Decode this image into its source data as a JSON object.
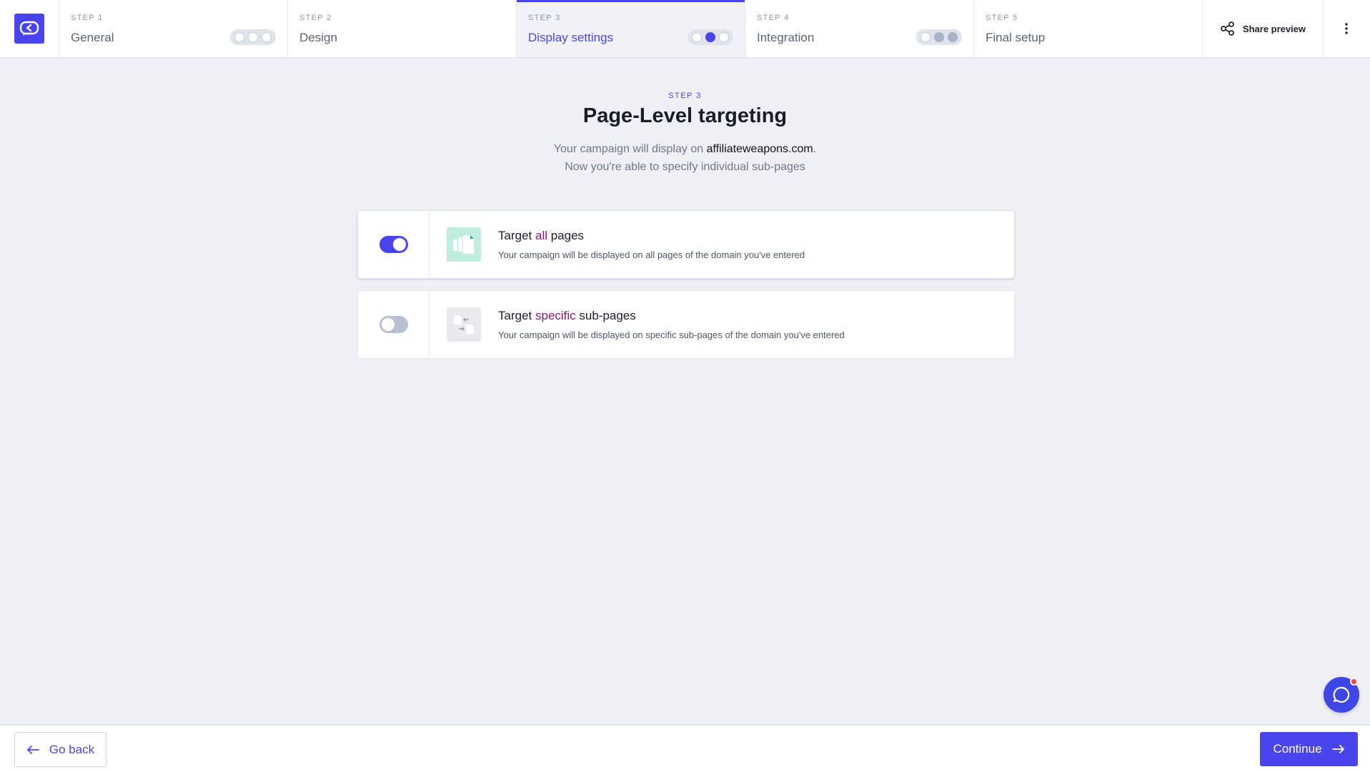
{
  "steps": [
    {
      "kicker": "STEP 1",
      "title": "General",
      "dots": [
        "empty",
        "empty",
        "empty"
      ]
    },
    {
      "kicker": "STEP 2",
      "title": "Design"
    },
    {
      "kicker": "STEP 3",
      "title": "Display settings",
      "active": true,
      "dots": [
        "empty",
        "filled",
        "empty"
      ]
    },
    {
      "kicker": "STEP 4",
      "title": "Integration",
      "dots": [
        "empty",
        "muted",
        "muted"
      ]
    },
    {
      "kicker": "STEP 5",
      "title": "Final setup"
    }
  ],
  "toolbar": {
    "share_label": "Share preview"
  },
  "header": {
    "kicker": "STEP 3",
    "title": "Page-Level targeting",
    "line1_prefix": "Your campaign will display on ",
    "domain": "affiliateweapons.com",
    "line1_suffix": ".",
    "line2": "Now you're able to specify individual sub-pages"
  },
  "options": [
    {
      "title_prefix": "Target ",
      "title_accent": "all",
      "title_suffix": " pages",
      "description": "Your campaign will be displayed on all pages of the domain you've entered",
      "enabled": true
    },
    {
      "title_prefix": "Target ",
      "title_accent": "specific",
      "title_suffix": " sub-pages",
      "description": "Your campaign will be displayed on specific sub-pages of the domain you've entered",
      "enabled": false
    }
  ],
  "footer": {
    "back_label": "Go back",
    "continue_label": "Continue"
  },
  "colors": {
    "accent": "#4a44ee",
    "highlight": "#8b1a64",
    "background": "#eff0f6"
  }
}
